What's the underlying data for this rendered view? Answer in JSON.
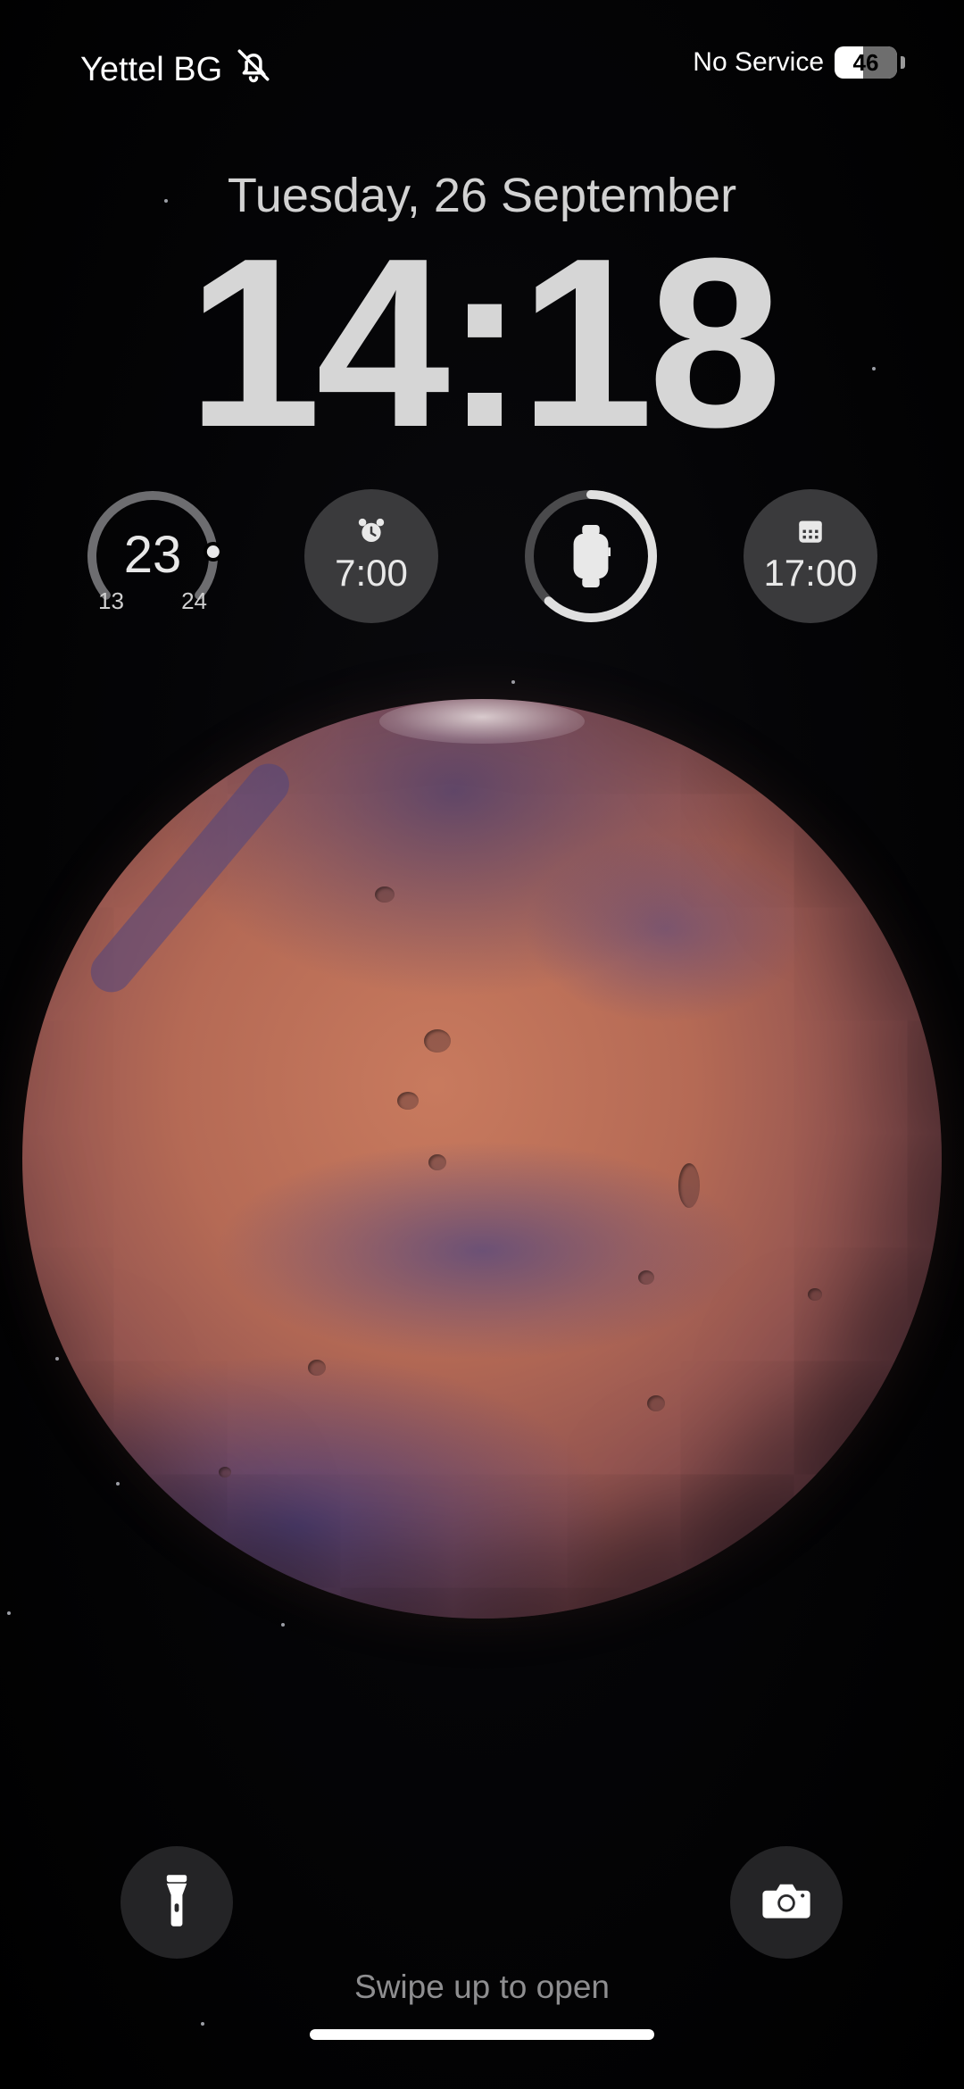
{
  "status_bar": {
    "carrier": "Yettel BG",
    "carrier_icon": "bell-slash-icon",
    "network_status": "No Service",
    "battery_level": "46",
    "battery_fraction": 0.46
  },
  "lock_screen": {
    "date": "Tuesday, 26 September",
    "time": "14:18"
  },
  "widgets": {
    "weather": {
      "temperature": "23",
      "low": "13",
      "high": "24",
      "gauge_fraction": 0.83
    },
    "alarm": {
      "icon": "alarm-clock-icon",
      "time": "7:00"
    },
    "watch_battery": {
      "icon": "apple-watch-icon",
      "level_fraction": 0.62
    },
    "calendar": {
      "icon": "calendar-icon",
      "time": "17:00"
    }
  },
  "bottom": {
    "flashlight_icon": "flashlight-icon",
    "camera_icon": "camera-icon",
    "hint": "Swipe up to open"
  },
  "colors": {
    "background": "#000000",
    "widget_bg": "#3a3a3c",
    "text_primary": "#d6d6d6",
    "hint_text": "#8e8e90",
    "mars_base": "#b56a55"
  }
}
